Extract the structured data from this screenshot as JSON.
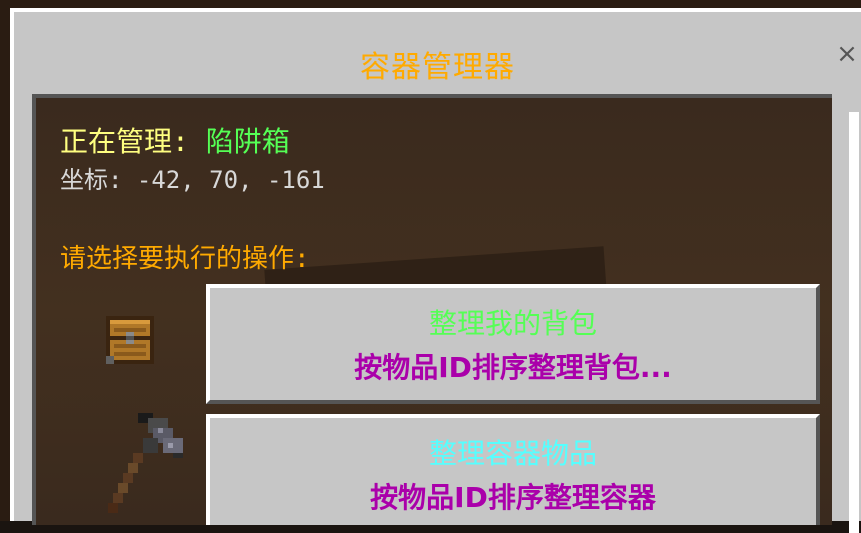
{
  "window": {
    "title": "容器管理器",
    "close_label": "×"
  },
  "info": {
    "managing_label": "正在管理: ",
    "managing_target": "陷阱箱",
    "coords_label": "坐标: ",
    "coords_value": "-42, 70, -161",
    "prompt": "请选择要执行的操作:"
  },
  "actions": [
    {
      "title": "整理我的背包",
      "subtitle": "按物品ID排序整理背包...",
      "icon": "chest-icon"
    },
    {
      "title": "整理容器物品",
      "subtitle": "按物品ID排序整理容器",
      "icon": "hammer-icon"
    }
  ],
  "colors": {
    "title": "#ffaa00",
    "managing_label": "#ffff80",
    "managing_target": "#55ff55",
    "prompt": "#ffaa00",
    "action1_title": "#55ff55",
    "action2_title": "#55ffff",
    "action_subtitle": "#aa00aa"
  }
}
